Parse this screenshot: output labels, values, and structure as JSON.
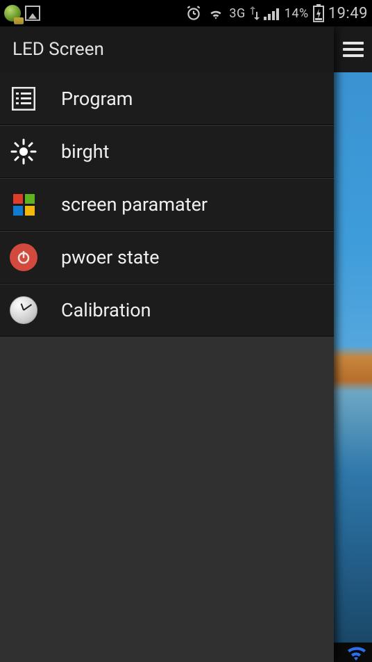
{
  "status": {
    "network_label": "3G",
    "battery_pct": "14%",
    "time": "19:49"
  },
  "drawer": {
    "title": "LED Screen",
    "items": [
      {
        "label": "Program"
      },
      {
        "label": "birght"
      },
      {
        "label": "screen paramater"
      },
      {
        "label": "pwoer state"
      },
      {
        "label": "Calibration"
      }
    ]
  }
}
